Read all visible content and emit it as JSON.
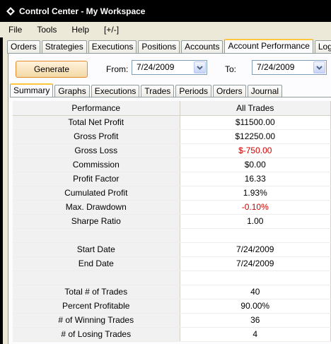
{
  "window": {
    "title": "Control Center - My Workspace"
  },
  "menu": [
    "File",
    "Tools",
    "Help",
    "[+/-]"
  ],
  "main_tabs": [
    "Orders",
    "Strategies",
    "Executions",
    "Positions",
    "Accounts",
    "Account Performance",
    "Log"
  ],
  "active_main_tab": "Account Performance",
  "toolbar": {
    "generate_label": "Generate",
    "from_label": "From:",
    "from_value": "7/24/2009",
    "to_label": "To:",
    "to_value": "7/24/2009"
  },
  "sub_tabs": [
    "Summary",
    "Graphs",
    "Executions",
    "Trades",
    "Periods",
    "Orders",
    "Journal"
  ],
  "active_sub_tab": "Summary",
  "table": {
    "headers": [
      "Performance",
      "All Trades"
    ],
    "rows": [
      {
        "label": "Total Net Profit",
        "value": "$11500.00",
        "negative": false
      },
      {
        "label": "Gross Profit",
        "value": "$12250.00",
        "negative": false
      },
      {
        "label": "Gross Loss",
        "value": "$-750.00",
        "negative": true
      },
      {
        "label": "Commission",
        "value": "$0.00",
        "negative": false
      },
      {
        "label": "Profit Factor",
        "value": "16.33",
        "negative": false
      },
      {
        "label": "Cumulated Profit",
        "value": "1.93%",
        "negative": false
      },
      {
        "label": "Max. Drawdown",
        "value": "-0.10%",
        "negative": true
      },
      {
        "label": "Sharpe Ratio",
        "value": "1.00",
        "negative": false
      },
      {
        "label": "",
        "value": "",
        "negative": false
      },
      {
        "label": "Start Date",
        "value": "7/24/2009",
        "negative": false
      },
      {
        "label": "End Date",
        "value": "7/24/2009",
        "negative": false
      },
      {
        "label": "",
        "value": "",
        "negative": false
      },
      {
        "label": "Total # of Trades",
        "value": "40",
        "negative": false
      },
      {
        "label": "Percent Profitable",
        "value": "90.00%",
        "negative": false
      },
      {
        "label": "# of Winning Trades",
        "value": "36",
        "negative": false
      },
      {
        "label": "# of Losing Trades",
        "value": "4",
        "negative": false
      }
    ]
  },
  "colors": {
    "negative": "#d00000",
    "active_tab_accent": "#ffc83c",
    "generate_border": "#e68b2c"
  }
}
